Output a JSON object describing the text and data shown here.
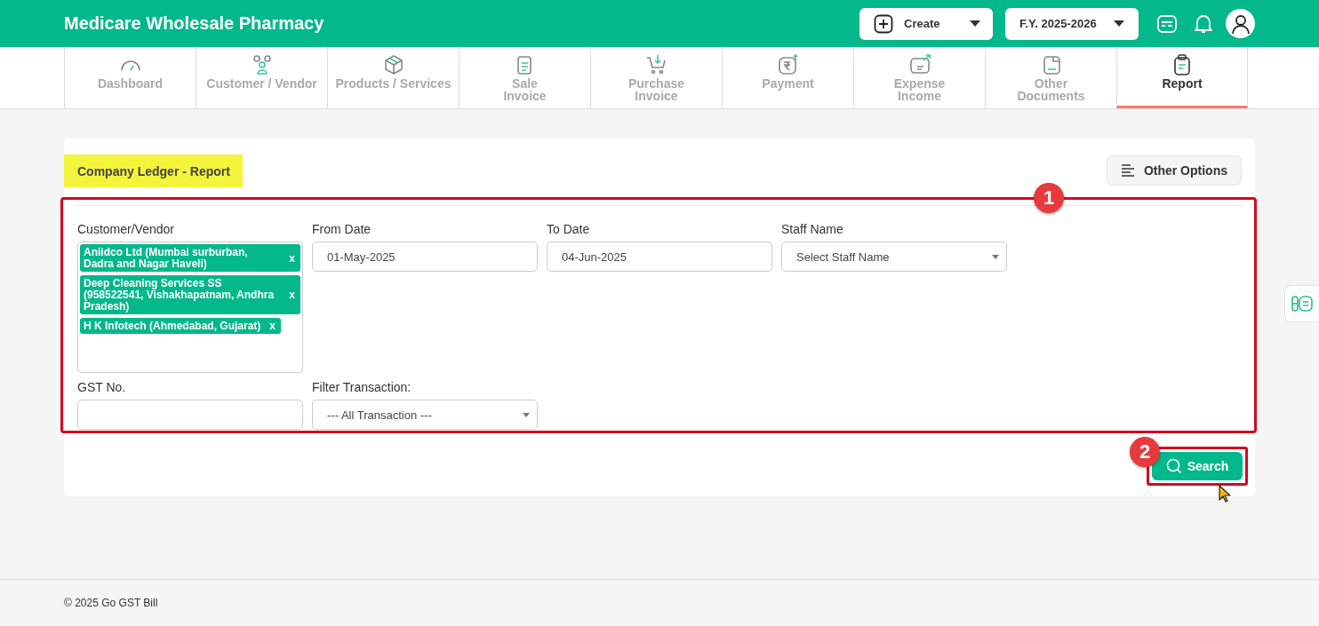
{
  "header": {
    "title": "Medicare Wholesale Pharmacy",
    "create_button": "Create",
    "fiscal_year": "F.Y. 2025-2026"
  },
  "tabs": [
    {
      "label": "Dashboard",
      "selected": false
    },
    {
      "label": "Customer / Vendor",
      "selected": false
    },
    {
      "label": "Products / Services",
      "selected": false
    },
    {
      "label": "Sale\nInvoice",
      "selected": false
    },
    {
      "label": "Purchase\nInvoice",
      "selected": false
    },
    {
      "label": "Payment",
      "selected": false
    },
    {
      "label": "Expense\nIncome",
      "selected": false
    },
    {
      "label": "Other\nDocuments",
      "selected": false
    },
    {
      "label": "Report",
      "selected": true
    }
  ],
  "report": {
    "title": "Company Ledger - Report",
    "other_options": "Other Options",
    "customer_vendor": {
      "label": "Customer/Vendor",
      "tags": [
        {
          "text": "Aniidco Ltd (Mumbai surburban, Dadra and Nagar Haveli)",
          "remove": "x"
        },
        {
          "text": "Deep Cleaning Services SS (958522541, Vishakhapatnam, Andhra Pradesh)",
          "remove": "x"
        },
        {
          "text": "H K Infotech (Ahmedabad, Gujarat)",
          "remove": "x"
        }
      ]
    },
    "from_date": {
      "label": "From Date",
      "value": "01-May-2025"
    },
    "to_date": {
      "label": "To Date",
      "value": "04-Jun-2025"
    },
    "staff_name": {
      "label": "Staff Name",
      "value": "Select Staff Name"
    },
    "gst_no": {
      "label": "GST No."
    },
    "filter_transaction": {
      "label": "Filter Transaction:",
      "value": "--- All Transaction ---"
    },
    "search_button": "Search"
  },
  "annotations": [
    {
      "number": "1"
    },
    {
      "number": "2"
    }
  ],
  "footer": "© 2025 Go GST Bill"
}
